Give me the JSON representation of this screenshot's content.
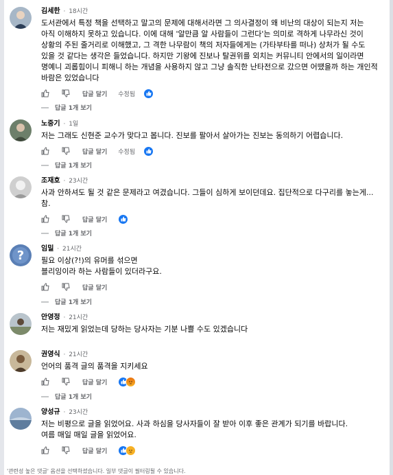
{
  "comments": [
    {
      "author": "김세한",
      "time": "18시간",
      "text": "도서관에서 특정 책을 선택하고 말고의 문제에 대해서라면 그 의사결정이 왜 비난의 대상이 되는지 저는 아직 이해하지 못하고 있습니다. 이에 대해 '알만큼 알 사람들이 그런다'는 의미로 격하게 나무라신 것이 상황의 주된 줄거리로 이해했고, 그 격한 나무람이 책의 저자들에게는 (가타부타를 떠나) 상처가 될 수도 있을 것 같다는 생각은 들었습니다. 하지만 기왕에 진보나 탈권위를 외치는 커뮤니티 안에서의 일이라면 명예니 괴롭힘이니 피해니 하는 개념을 사용하지 않고 그냥 솔직한 난타전으로 갔으면 어땠을까 하는 개인적 바람은 있었습니다",
      "reply": "답글 달기",
      "edited": "수정됨",
      "view_replies": "답글 1개 보기"
    },
    {
      "author": "노중기",
      "time": "1일",
      "text": "저는 그래도 신현준 교수가 맞다고 봅니다. 진보를 팔아서 살아가는 진보는 동의하기 어렵습니다.",
      "reply": "답글 달기",
      "edited": "수정됨",
      "view_replies": "답글 1개 보기"
    },
    {
      "author": "조재호",
      "time": "23시간",
      "text": "사과 안하셔도 될 것 같은 문제라고 여겼습니다. 그들이 심하게 보이던데요. 집단적으로 다구리를 놓는게...참.",
      "reply": "답글 달기",
      "view_replies": "답글 1개 보기"
    },
    {
      "author": "임밀",
      "time": "21시간",
      "text_lines": [
        "필요 이상(?!)의 유머를 섞으면",
        "블리잉이라 하는 사람들이 있더라구요."
      ],
      "reply": "답글 달기",
      "view_replies": "답글 1개 보기"
    },
    {
      "author": "안영정",
      "time": "21시간",
      "text": "저는 재밌게 읽었는데 당하는 당사자는 기분 나쁠 수도 있겠습니다"
    },
    {
      "author": "권영식",
      "time": "21시간",
      "text": "언어의 품격 글의 품격을 지키세요",
      "reply": "답글 달기",
      "view_replies": "답글 1개 보기"
    },
    {
      "author": "양성규",
      "time": "23시간",
      "text_lines": [
        "저는 비평으로 글을 읽었어요. 사과 하심을 당사자들이 잘 받아 이후 좋은 관계가 되기를 바랍니다.",
        "여름 매일 매일 글을 읽었어요."
      ],
      "reply": "답글 달기"
    }
  ],
  "footer_note": "'관련성 높은 댓글' 옵션을 선택하셨습니다. 일부 댓글이 필터링될 수 있습니다.",
  "colors": {
    "accent": "#1877f2",
    "text": "#050505",
    "muted": "#65676b"
  }
}
